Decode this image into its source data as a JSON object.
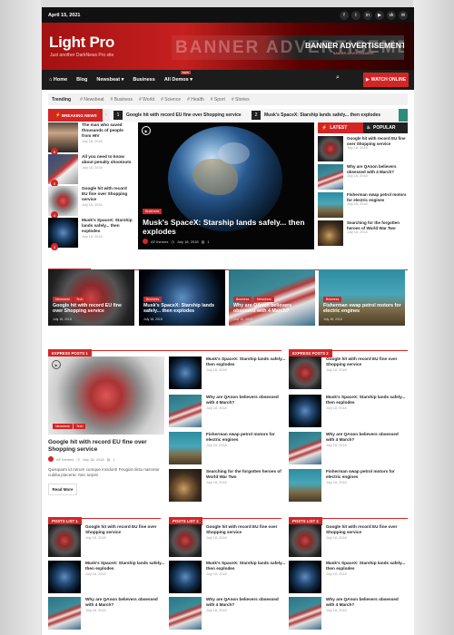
{
  "topbar": {
    "date": "April 15, 2021",
    "social": [
      "f",
      "t",
      "in",
      "▶",
      "vk",
      "✉"
    ]
  },
  "header": {
    "logo": "Light Pro",
    "tagline": "Just another DarkNews Pro site",
    "banner_big": "BANNER ADVERTISEMENT",
    "banner_label": "BANNER ADVERTISEMENT",
    "banner_sub": "BANNER ADVERTISEMENT"
  },
  "nav": {
    "items": [
      "Home",
      "Blog",
      "Newsbeat ▾",
      "Business",
      "All Demos ▾"
    ],
    "badge": "NEW",
    "watch": "WATCH ONLINE"
  },
  "trending": {
    "label": "Trending",
    "items": [
      "# Newsbeat",
      "# Business",
      "# World",
      "# Science",
      "# Health",
      "# Sport",
      "# Stories"
    ]
  },
  "breaking": {
    "label": "BREAKING NEWS",
    "items": [
      {
        "num": "1",
        "text": "Google hit with record EU fine over Shopping service"
      },
      {
        "num": "2",
        "text": "Musk's SpaceX: Starship lands safely... then explodes"
      }
    ]
  },
  "hero": {
    "left": [
      {
        "title": "The man who saved thousands of people from HIV",
        "date": "July 18, 2018",
        "num": "6"
      },
      {
        "title": "All you need to know about penalty shootouts",
        "date": "July 18, 2018",
        "num": "5"
      },
      {
        "title": "Google hit with record EU fine over Shopping service",
        "date": "July 18, 2018",
        "num": "4"
      },
      {
        "title": "Musk's SpaceX: Starship lands safely... then explodes",
        "date": "July 18, 2018",
        "num": "3"
      }
    ],
    "main": {
      "category": "Business",
      "title": "Musk's SpaceX: Starship lands safely... then explodes",
      "author": "AF themes",
      "date": "July 18, 2018",
      "comments": "1"
    },
    "tabs": [
      "LATEST",
      "POPULAR"
    ],
    "right": [
      {
        "title": "Google hit with record EU fine over Shopping service",
        "date": "July 18, 2018"
      },
      {
        "title": "Why are QAnon believers obsessed with 4 March?",
        "date": "July 18, 2018"
      },
      {
        "title": "Fisherman swap petrol motors for electric engines",
        "date": "July 18, 2018"
      },
      {
        "title": "Searching for the forgotten heroes of World War Two",
        "date": "July 18, 2018"
      }
    ]
  },
  "featured": {
    "label": "FEATURED POSTS",
    "items": [
      {
        "cat": "Newsbeat",
        "cat2": "Tech",
        "title": "Google hit with record EU fine over Shopping service",
        "date": "July 18, 2018"
      },
      {
        "cat": "Business",
        "cat2": "",
        "title": "Musk's SpaceX: Starship lands safely... then explodes",
        "date": "July 18, 2018"
      },
      {
        "cat": "Business",
        "cat2": "Newsbeat",
        "title": "Why are QAnon believers obsessed with 4 March?",
        "date": "July 18, 2018"
      },
      {
        "cat": "Business",
        "cat2": "",
        "title": "Fisherman swap petrol motors for electric engines",
        "date": "July 18, 2018"
      }
    ]
  },
  "express1": {
    "label": "EXPRESS POSTS 1",
    "big": {
      "cat": "Newsbeat",
      "cat2": "Tech",
      "title": "Google hit with record EU fine over Shopping service",
      "author": "AF themes",
      "date": "July 18, 2018",
      "comments": "1",
      "excerpt": "Quisquam id rutrum cumque incidunt! Feugiat dicta nascetur cubilia placerat. Nec turpis!",
      "readmore": "Read More"
    },
    "list": [
      {
        "title": "Musk's SpaceX: Starship lands safely... then explodes",
        "date": "July 18, 2018"
      },
      {
        "title": "Why are QAnon believers obsessed with 4 March?",
        "date": "July 18, 2018"
      },
      {
        "title": "Fisherman swap petrol motors for electric engines",
        "date": "July 18, 2018"
      },
      {
        "title": "Searching for the forgotten heroes of World War Two",
        "date": "July 18, 2018"
      }
    ]
  },
  "express2": {
    "label": "EXPRESS POSTS 2",
    "list": [
      {
        "title": "Google hit with record EU fine over Shopping service",
        "date": "July 18, 2018"
      },
      {
        "title": "Musk's SpaceX: Starship lands safely... then explodes",
        "date": "July 18, 2018"
      },
      {
        "title": "Why are QAnon believers obsessed with 4 March?",
        "date": "July 18, 2018"
      },
      {
        "title": "Fisherman swap petrol motors for electric engines",
        "date": "July 18, 2018"
      }
    ]
  },
  "posts1": {
    "label": "POSTS LIST 1",
    "list": [
      {
        "title": "Google hit with record EU fine over Shopping service",
        "date": "July 18, 2018"
      },
      {
        "title": "Musk's SpaceX: Starship lands safely... then explodes",
        "date": "July 18, 2018"
      },
      {
        "title": "Why are QAnon believers obsessed with 4 March?",
        "date": "July 18, 2018"
      }
    ]
  },
  "posts2": {
    "label": "POSTS LIST 2",
    "list": [
      {
        "title": "Google hit with record EU fine over Shopping service",
        "date": "July 18, 2018"
      },
      {
        "title": "Musk's SpaceX: Starship lands safely... then explodes",
        "date": "July 18, 2018"
      },
      {
        "title": "Why are QAnon believers obsessed with 4 March?",
        "date": "July 18, 2018"
      }
    ]
  },
  "posts3": {
    "label": "POSTS LIST 3",
    "list": [
      {
        "title": "Google hit with record EU fine over Shopping service",
        "date": "July 18, 2018"
      },
      {
        "title": "Musk's SpaceX: Starship lands safely... then explodes",
        "date": "July 18, 2018"
      },
      {
        "title": "Why are QAnon believers obsessed with 4 March?",
        "date": "July 18, 2018"
      }
    ]
  },
  "colors": {
    "accent": "#d42525",
    "dark": "#1c1c1c"
  }
}
